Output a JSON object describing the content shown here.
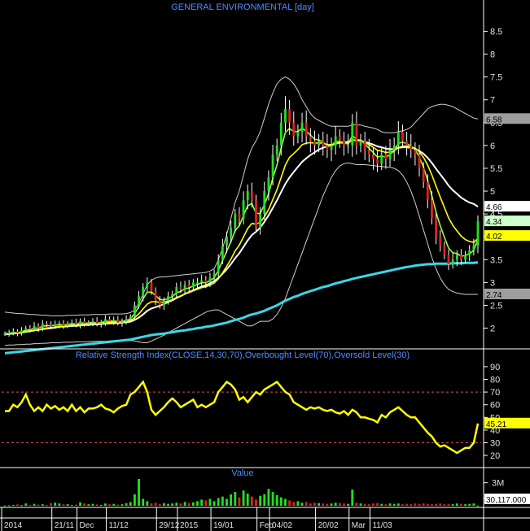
{
  "chart_data": [
    {
      "type": "candlestick",
      "title": "GENERAL ENVIRONMENTAL [day]",
      "y_ticks": [
        "8.5",
        "8",
        "7.5",
        "7",
        "6.5",
        "6",
        "5.5",
        "5",
        "4.5",
        "4",
        "3.5",
        "3",
        "2.5",
        "2"
      ],
      "ylim": [
        1.6,
        8.9
      ],
      "grid": false,
      "value_tags": [
        {
          "label": "6.58",
          "value": 6.58,
          "color": "#9e9e9e",
          "text": "#000000"
        },
        {
          "label": "4.66",
          "value": 4.66,
          "color": "#ffffff",
          "text": "#000000"
        },
        {
          "label": "4.34",
          "value": 4.34,
          "color": "#ccffcc",
          "text": "#000000"
        },
        {
          "label": "4.02",
          "value": 4.02,
          "color": "#ffff00",
          "text": "#000000"
        },
        {
          "label": "2.74",
          "value": 2.74,
          "color": "#9e9e9e",
          "text": "#000000"
        }
      ],
      "series": [
        {
          "name": "close",
          "values": [
            1.88,
            1.9,
            1.92,
            1.9,
            1.95,
            2.0,
            1.98,
            2.05,
            2.0,
            2.1,
            2.08,
            2.05,
            2.08,
            2.1,
            2.05,
            2.1,
            2.12,
            2.08,
            2.15,
            2.1,
            2.12,
            2.15,
            2.1,
            2.12,
            2.2,
            2.15,
            2.18,
            2.12,
            2.15,
            2.2,
            2.25,
            2.5,
            2.7,
            2.9,
            3.0,
            2.8,
            2.6,
            2.5,
            2.6,
            2.7,
            2.75,
            2.9,
            2.85,
            2.95,
            2.9,
            3.0,
            3.0,
            3.05,
            3.0,
            3.1,
            3.2,
            3.5,
            3.8,
            4.0,
            4.2,
            4.5,
            4.4,
            4.8,
            5.0,
            4.8,
            4.2,
            4.5,
            5.0,
            5.3,
            5.8,
            6.0,
            6.5,
            6.8,
            6.5,
            6.2,
            6.3,
            6.5,
            6.2,
            6.1,
            6.0,
            6.1,
            6.0,
            5.9,
            6.0,
            6.2,
            6.1,
            6.0,
            6.0,
            6.5,
            6.0,
            6.1,
            5.9,
            5.8,
            5.7,
            5.6,
            5.8,
            5.7,
            5.9,
            6.0,
            6.3,
            6.1,
            6.0,
            5.9,
            5.8,
            5.5,
            5.2,
            4.8,
            4.4,
            4.0,
            3.8,
            3.6,
            3.4,
            3.5,
            3.6,
            3.5,
            3.6,
            3.7,
            3.8,
            4.34
          ]
        },
        {
          "name": "moving-average-white",
          "values": [
            1.86,
            1.87,
            1.88,
            1.89,
            1.9,
            1.92,
            1.93,
            1.95,
            1.96,
            1.98,
            1.99,
            2.0,
            2.01,
            2.03,
            2.03,
            2.04,
            2.05,
            2.05,
            2.06,
            2.07,
            2.07,
            2.08,
            2.08,
            2.09,
            2.1,
            2.1,
            2.11,
            2.11,
            2.12,
            2.13,
            2.14,
            2.18,
            2.23,
            2.3,
            2.38,
            2.43,
            2.46,
            2.49,
            2.53,
            2.57,
            2.61,
            2.66,
            2.7,
            2.75,
            2.79,
            2.83,
            2.87,
            2.91,
            2.94,
            2.98,
            3.03,
            3.1,
            3.19,
            3.29,
            3.4,
            3.53,
            3.64,
            3.78,
            3.92,
            4.04,
            4.11,
            4.2,
            4.33,
            4.47,
            4.63,
            4.8,
            4.98,
            5.16,
            5.3,
            5.42,
            5.53,
            5.64,
            5.72,
            5.79,
            5.85,
            5.91,
            5.95,
            5.98,
            6.0,
            6.04,
            6.06,
            6.07,
            6.08,
            6.12,
            6.11,
            6.1,
            6.08,
            6.05,
            6.02,
            5.98,
            5.96,
            5.93,
            5.92,
            5.92,
            5.95,
            5.96,
            5.96,
            5.95,
            5.93,
            5.88,
            5.82,
            5.73,
            5.62,
            5.49,
            5.37,
            5.25,
            5.12,
            5.02,
            4.94,
            4.86,
            4.8,
            4.75,
            4.72,
            4.66
          ]
        },
        {
          "name": "moving-average-cyan",
          "values": [
            1.45,
            1.46,
            1.47,
            1.48,
            1.49,
            1.5,
            1.51,
            1.52,
            1.53,
            1.54,
            1.55,
            1.56,
            1.57,
            1.58,
            1.59,
            1.6,
            1.61,
            1.62,
            1.63,
            1.64,
            1.65,
            1.66,
            1.67,
            1.68,
            1.69,
            1.7,
            1.71,
            1.72,
            1.73,
            1.74,
            1.75,
            1.77,
            1.79,
            1.81,
            1.83,
            1.85,
            1.86,
            1.87,
            1.88,
            1.9,
            1.91,
            1.93,
            1.94,
            1.95,
            1.97,
            1.98,
            2.0,
            2.01,
            2.03,
            2.04,
            2.06,
            2.08,
            2.1,
            2.12,
            2.15,
            2.18,
            2.2,
            2.23,
            2.27,
            2.3,
            2.32,
            2.35,
            2.38,
            2.42,
            2.46,
            2.5,
            2.55,
            2.6,
            2.64,
            2.68,
            2.71,
            2.75,
            2.78,
            2.81,
            2.84,
            2.87,
            2.9,
            2.92,
            2.95,
            2.98,
            3.0,
            3.03,
            3.05,
            3.08,
            3.1,
            3.12,
            3.14,
            3.16,
            3.18,
            3.2,
            3.22,
            3.24,
            3.26,
            3.28,
            3.3,
            3.32,
            3.34,
            3.35,
            3.37,
            3.38,
            3.39,
            3.4,
            3.4,
            3.41,
            3.41,
            3.41,
            3.41,
            3.42,
            3.42,
            3.42,
            3.43,
            3.43,
            3.43,
            3.44
          ]
        },
        {
          "name": "bollinger-upper",
          "values": [
            2.35,
            2.34,
            2.33,
            2.32,
            2.32,
            2.31,
            2.3,
            2.3,
            2.29,
            2.28,
            2.28,
            2.27,
            2.27,
            2.27,
            2.27,
            2.28,
            2.28,
            2.28,
            2.29,
            2.29,
            2.29,
            2.3,
            2.3,
            2.3,
            2.3,
            2.31,
            2.31,
            2.31,
            2.31,
            2.32,
            2.34,
            2.4,
            2.55,
            2.75,
            2.95,
            3.05,
            3.1,
            3.12,
            3.12,
            3.13,
            3.14,
            3.15,
            3.16,
            3.17,
            3.18,
            3.19,
            3.2,
            3.21,
            3.22,
            3.25,
            3.3,
            3.5,
            3.75,
            4.05,
            4.4,
            4.75,
            5.0,
            5.35,
            5.7,
            5.95,
            6.1,
            6.3,
            6.6,
            6.9,
            7.15,
            7.35,
            7.45,
            7.5,
            7.45,
            7.35,
            7.2,
            7.0,
            6.85,
            6.7,
            6.6,
            6.55,
            6.5,
            6.45,
            6.42,
            6.42,
            6.42,
            6.42,
            6.42,
            6.45,
            6.45,
            6.45,
            6.42,
            6.4,
            6.38,
            6.35,
            6.3,
            6.28,
            6.28,
            6.28,
            6.3,
            6.32,
            6.35,
            6.4,
            6.5,
            6.6,
            6.7,
            6.8,
            6.85,
            6.88,
            6.9,
            6.9,
            6.88,
            6.85,
            6.8,
            6.75,
            6.7,
            6.65,
            6.6,
            6.58
          ]
        },
        {
          "name": "bollinger-lower",
          "values": [
            1.62,
            1.63,
            1.63,
            1.64,
            1.64,
            1.65,
            1.65,
            1.66,
            1.66,
            1.67,
            1.67,
            1.68,
            1.68,
            1.68,
            1.69,
            1.69,
            1.69,
            1.7,
            1.7,
            1.7,
            1.7,
            1.71,
            1.71,
            1.71,
            1.71,
            1.72,
            1.72,
            1.72,
            1.73,
            1.73,
            1.73,
            1.72,
            1.7,
            1.68,
            1.68,
            1.72,
            1.76,
            1.8,
            1.85,
            1.9,
            1.95,
            2.0,
            2.05,
            2.1,
            2.15,
            2.2,
            2.25,
            2.3,
            2.35,
            2.38,
            2.4,
            2.4,
            2.35,
            2.3,
            2.25,
            2.2,
            2.15,
            2.1,
            2.05,
            2.05,
            2.1,
            2.15,
            2.15,
            2.15,
            2.2,
            2.3,
            2.45,
            2.65,
            2.9,
            3.15,
            3.4,
            3.65,
            3.9,
            4.15,
            4.4,
            4.65,
            4.9,
            5.1,
            5.3,
            5.45,
            5.55,
            5.6,
            5.62,
            5.6,
            5.58,
            5.58,
            5.58,
            5.57,
            5.56,
            5.55,
            5.54,
            5.53,
            5.52,
            5.5,
            5.45,
            5.35,
            5.2,
            5.0,
            4.75,
            4.45,
            4.15,
            3.85,
            3.55,
            3.3,
            3.1,
            2.95,
            2.85,
            2.8,
            2.77,
            2.75,
            2.74,
            2.74,
            2.74,
            2.74
          ]
        }
      ]
    },
    {
      "type": "line",
      "title": "Relative Strength Index(CLOSE,14,30,70),Overbought Level(70),Oversold Level(30)",
      "y_ticks": [
        "90",
        "80",
        "70",
        "60",
        "50",
        "40",
        "30",
        "20"
      ],
      "ylim": [
        13,
        97
      ],
      "reference_lines": [
        70,
        30
      ],
      "value_tags": [
        {
          "label": "45.21",
          "value": 45.21,
          "color": "#ffff00",
          "text": "#000000"
        }
      ],
      "series": [
        {
          "name": "rsi",
          "values": [
            55,
            55,
            60,
            58,
            62,
            68,
            60,
            55,
            58,
            55,
            60,
            57,
            59,
            56,
            58,
            55,
            60,
            55,
            58,
            54,
            57,
            57,
            58,
            60,
            57,
            56,
            54,
            57,
            59,
            60,
            68,
            70,
            74,
            78,
            70,
            56,
            52,
            55,
            58,
            62,
            65,
            62,
            58,
            60,
            62,
            64,
            58,
            60,
            58,
            60,
            62,
            70,
            74,
            78,
            76,
            72,
            64,
            66,
            62,
            66,
            70,
            68,
            72,
            74,
            76,
            78,
            74,
            70,
            68,
            62,
            60,
            58,
            56,
            58,
            57,
            58,
            56,
            55,
            56,
            54,
            53,
            55,
            52,
            56,
            54,
            50,
            50,
            49,
            48,
            46,
            52,
            50,
            54,
            56,
            58,
            55,
            52,
            50,
            50,
            46,
            42,
            38,
            35,
            30,
            27,
            28,
            26,
            24,
            22,
            24,
            26,
            26,
            30,
            45.21
          ]
        }
      ]
    },
    {
      "type": "bar",
      "title": "Value",
      "y_ticks": [
        "3M",
        "1M"
      ],
      "value_tags": [
        {
          "label": "30,117.000",
          "value": 30117,
          "color": "#ffffff",
          "text": "#000000"
        }
      ],
      "series": [
        {
          "name": "value",
          "values": [
            0.03,
            0.05,
            0.12,
            0.18,
            0.08,
            0.3,
            0.1,
            0.25,
            0.15,
            0.2,
            0.12,
            0.35,
            0.4,
            0.3,
            0.18,
            0.22,
            0.1,
            0.15,
            0.45,
            0.3,
            0.2,
            0.25,
            0.18,
            0.12,
            0.3,
            0.2,
            0.25,
            0.15,
            0.2,
            0.35,
            0.5,
            1.5,
            3.5,
            0.9,
            0.6,
            0.3,
            0.4,
            0.2,
            0.35,
            0.25,
            0.3,
            0.4,
            0.3,
            0.5,
            0.35,
            0.45,
            0.6,
            0.8,
            0.7,
            0.9,
            0.6,
            1.0,
            1.2,
            0.9,
            1.5,
            1.8,
            1.1,
            2.0,
            1.6,
            1.2,
            0.8,
            1.3,
            1.5,
            2.2,
            1.8,
            1.4,
            1.1,
            0.9,
            0.7,
            0.5,
            0.6,
            0.4,
            0.5,
            0.3,
            0.4,
            0.35,
            0.3,
            0.25,
            0.3,
            0.4,
            0.35,
            0.3,
            0.25,
            2.1,
            0.4,
            0.3,
            0.25,
            0.2,
            0.3,
            0.35,
            0.25,
            0.2,
            0.3,
            0.25,
            0.3,
            0.2,
            0.25,
            0.2,
            0.3,
            0.25,
            0.3,
            0.25,
            0.2,
            0.25,
            0.3,
            0.2,
            0.25,
            0.2,
            0.3,
            0.25,
            0.2,
            0.25,
            0.3,
            0.03
          ]
        }
      ]
    }
  ],
  "x_axis": {
    "labels": [
      {
        "text": "2014",
        "i": 0
      },
      {
        "text": "21/11",
        "i": 12
      },
      {
        "text": "Dec",
        "i": 18
      },
      {
        "text": "11/12",
        "i": 25
      },
      {
        "text": "29/12",
        "i": 37
      },
      {
        "text": "2015",
        "i": 42
      },
      {
        "text": "19/01",
        "i": 50
      },
      {
        "text": "Feb",
        "i": 61
      },
      {
        "text": "04/02",
        "i": 64
      },
      {
        "text": "20/02",
        "i": 75
      },
      {
        "text": "Mar",
        "i": 83
      },
      {
        "text": "11/03",
        "i": 88
      }
    ]
  }
}
